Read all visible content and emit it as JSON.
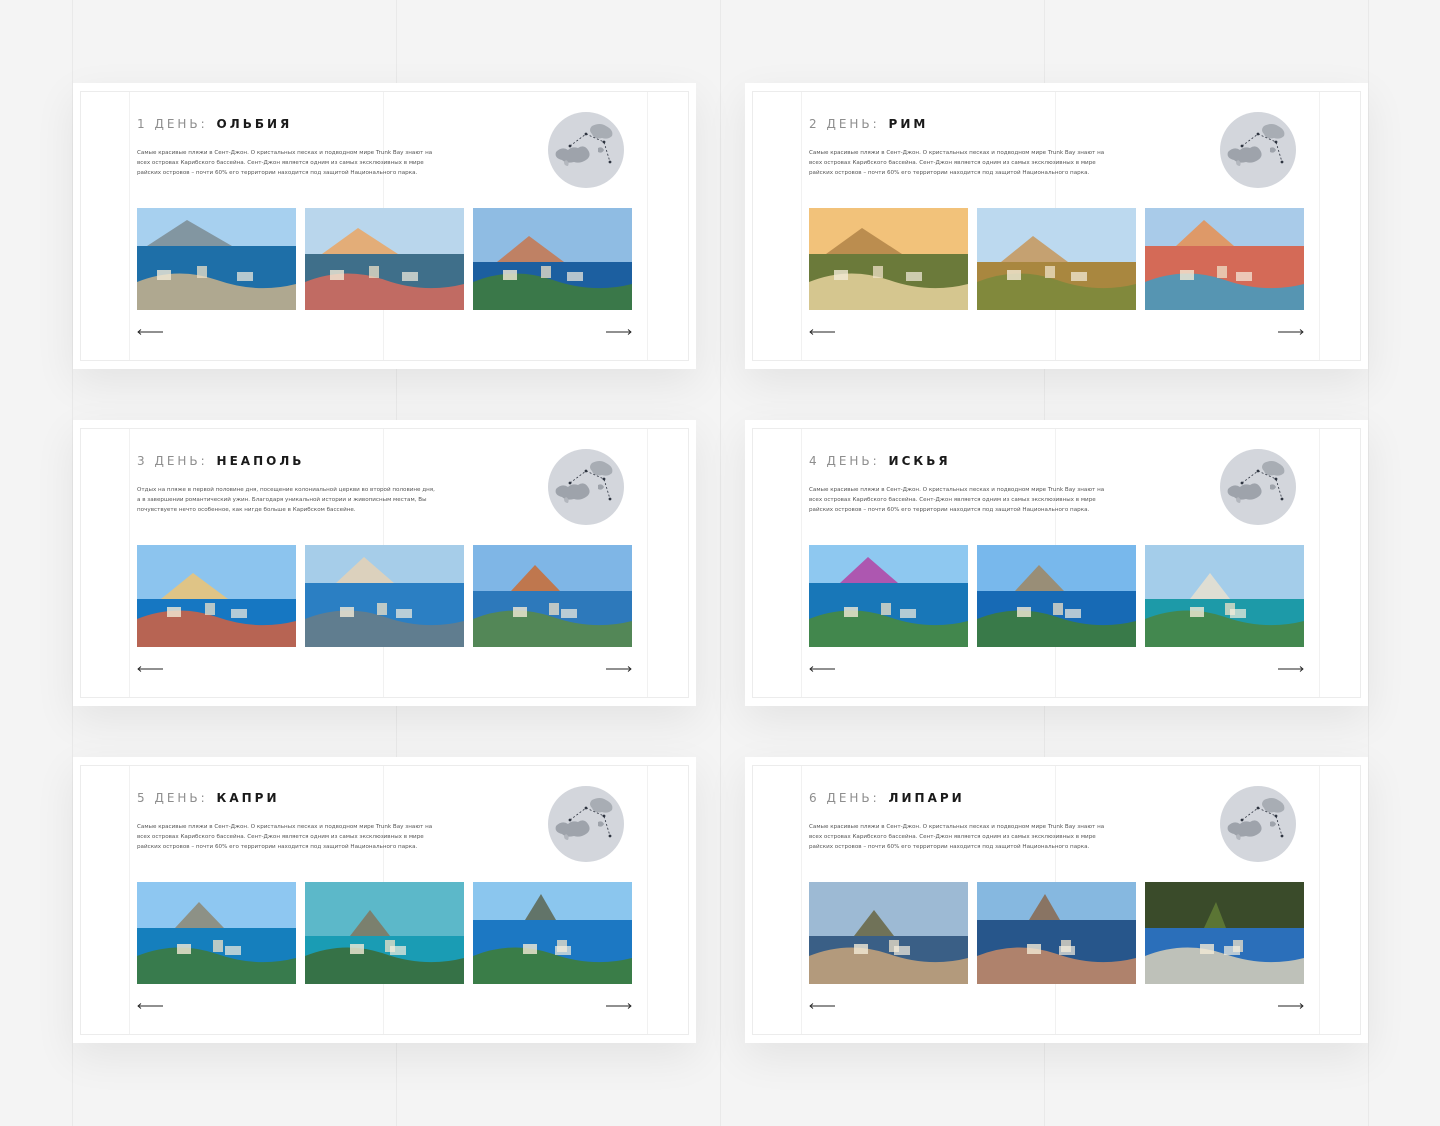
{
  "cards": [
    {
      "day": "1 ДЕНЬ:",
      "city": "ОЛЬБИЯ",
      "description": "Самые красивые пляжи в Сент-Джон. О кристальных песках и подводном мире Trunk Bay знают на всех островах Карибского бассейна. Сент-Джон является одним из самых эксклюзивных в мире райских островов – почти 60% его территории находится под защитой Национального парка.",
      "photos": [
        "island-rock-sea-photo",
        "colorful-harbor-town-photo",
        "coastal-town-bay-photo"
      ]
    },
    {
      "day": "2 ДЕНЬ:",
      "city": "РИМ",
      "description": "Самые красивые пляжи в Сент-Джон. О кристальных песках и подводном мире Trunk Bay знают на всех островах Карибского бассейна. Сент-Джон является одним из самых эксклюзивных в мире райских островов – почти 60% его территории находится под защитой Национального парка.",
      "photos": [
        "colosseum-photo",
        "roman-forum-photo",
        "spanish-steps-fountain-photo"
      ]
    },
    {
      "day": "3 ДЕНЬ:",
      "city": "НЕАПОЛЬ",
      "description": "Отдых на пляже в первой половине дня, посещение колониальной церкви во второй половине дня, а в завершении романтический ужин. Благодаря уникальной истории и живописным местам, Вы почувствуете нечто особенное, как нигде больше в Карибском бассейне.",
      "photos": [
        "positano-cliffs-photo",
        "naples-bay-vesuvius-photo",
        "naples-city-view-photo"
      ]
    },
    {
      "day": "4 ДЕНЬ:",
      "city": "ИСКЬЯ",
      "description": "Самые красивые пляжи в Сент-Джон. О кристальных песках и подводном мире Trunk Bay знают на всех островах Карибского бассейна. Сент-Джон является одним из самых эксклюзивных в мире райских островов – почти 60% его территории находится под защитой Национального парка.",
      "photos": [
        "flowers-sea-island-photo",
        "aragonese-castle-photo",
        "ischia-causeway-photo"
      ]
    },
    {
      "day": "5 ДЕНЬ:",
      "city": "КАПРИ",
      "description": "Самые красивые пляжи в Сент-Джон. О кристальных песках и подводном мире Trunk Bay знают на всех островах Карибского бассейна. Сент-Джон является одним из самых эксклюзивных в мире райских островов – почти 60% его территории находится под защитой Национального парка.",
      "photos": [
        "capri-cliffs-boats-photo",
        "capri-serpentine-road-photo",
        "faraglioni-rocks-photo"
      ]
    },
    {
      "day": "6 ДЕНЬ:",
      "city": "ЛИПАРИ",
      "description": "Самые красивые пляжи в Сент-Джон. О кристальных песках и подводном мире Trunk Bay знают на всех островах Карибского бассейна. Сент-Джон является одним из самых эксклюзивных в мире райских островов – почти 60% его территории находится под защитой Национального парка.",
      "photos": [
        "aeolian-islands-aerial-photo",
        "vulcano-island-photo",
        "cave-view-lipari-photo"
      ]
    }
  ],
  "icons": {
    "prev": "arrow-left-icon",
    "next": "arrow-right-icon",
    "map": "route-map-thumbnail"
  },
  "colors": {
    "background": "#f4f4f4",
    "card": "#ffffff",
    "map_circle": "#d3d6dc",
    "title_day": "#8e8e8e",
    "title_city": "#1a1a1a"
  }
}
